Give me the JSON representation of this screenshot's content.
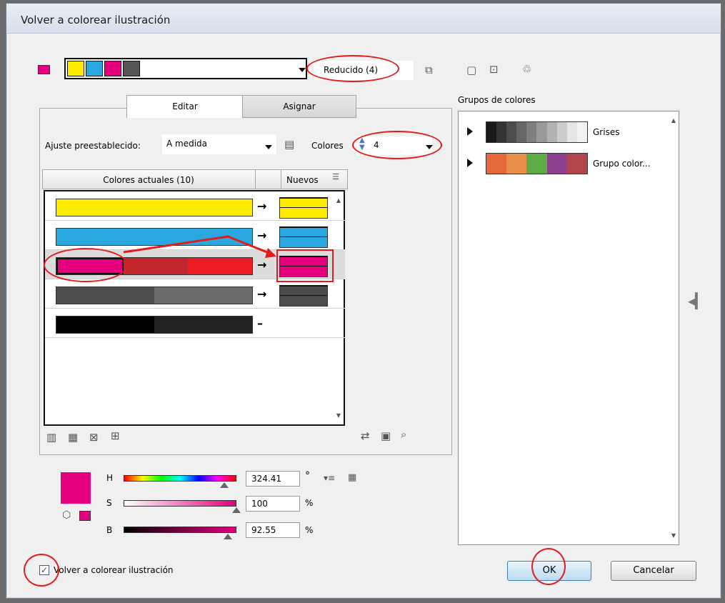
{
  "window": {
    "title": "Volver a colorear ilustración"
  },
  "top": {
    "colors": [
      "#ffec00",
      "#29a8e0",
      "#e5007e",
      "#555555"
    ],
    "active_swatch": "#e5007e",
    "name_value": "Reducido (4)"
  },
  "tabs": [
    {
      "label": "Editar"
    },
    {
      "label": "Asignar"
    }
  ],
  "preset": {
    "label": "Ajuste preestablecido:",
    "value": "A medida"
  },
  "colors_count": {
    "label": "Colores",
    "value": "4"
  },
  "table": {
    "header_current": "Colores actuales (10)",
    "header_new": "Nuevos",
    "rows": [
      {
        "current": [
          "#ffec00"
        ],
        "new": [
          "#ffec00"
        ],
        "mapped": true
      },
      {
        "current": [
          "#29a8e0"
        ],
        "new": [
          "#29a8e0"
        ],
        "mapped": true
      },
      {
        "current": [
          "#e5007e",
          "#c1272d",
          "#ed1c24"
        ],
        "new": [
          "#e5007e"
        ],
        "mapped": true
      },
      {
        "current": [
          "#4d4d4d",
          "#6b6b6b"
        ],
        "new": [
          "#4d4d4d"
        ],
        "mapped": true
      },
      {
        "current": [
          "#000000",
          "#222222"
        ],
        "new": [],
        "mapped": false
      }
    ],
    "arrow": "→",
    "dash": "–"
  },
  "hsb": {
    "swatch": "#e5007e",
    "h": {
      "label": "H",
      "value": "324.41",
      "unit": "°"
    },
    "s": {
      "label": "S",
      "value": "100",
      "unit": "%"
    },
    "b": {
      "label": "B",
      "value": "92.55",
      "unit": "%"
    }
  },
  "recolor_checkbox": {
    "label": "Volver a colorear ilustración",
    "checked": true
  },
  "groups": {
    "title": "Grupos de colores",
    "items": [
      {
        "name": "Grises",
        "colors": [
          "#1a1a1a",
          "#333333",
          "#4d4d4d",
          "#666666",
          "#808080",
          "#999999",
          "#b3b3b3",
          "#cccccc",
          "#e6e6e6",
          "#f2f2f2"
        ]
      },
      {
        "name": "Grupo color...",
        "colors": [
          "#e5683c",
          "#e8904a",
          "#5cab47",
          "#8e3f8f",
          "#b2444c"
        ]
      }
    ]
  },
  "buttons": {
    "ok": "OK",
    "cancel": "Cancelar"
  }
}
